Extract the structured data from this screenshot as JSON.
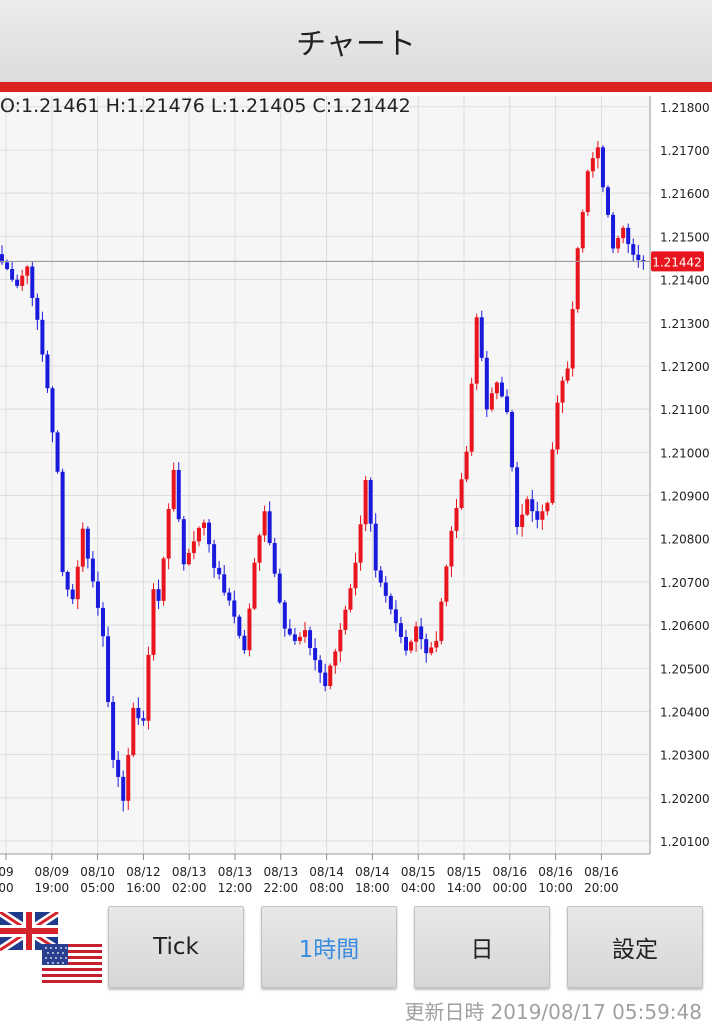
{
  "header": {
    "title": "チャート"
  },
  "ohlc": {
    "text": "O:1.21461 H:1.21476 L:1.21405 C:1.21442"
  },
  "chart_data": {
    "type": "candlestick",
    "y_ticks": [
      "1.21800",
      "1.21700",
      "1.21600",
      "1.21500",
      "1.21400",
      "1.21300",
      "1.21200",
      "1.21100",
      "1.21000",
      "1.20900",
      "1.20800",
      "1.20700",
      "1.20600",
      "1.20500",
      "1.20400",
      "1.20300",
      "1.20200",
      "1.20100"
    ],
    "ylim": [
      1.2007,
      1.21825
    ],
    "current_price": 1.21442,
    "current_price_label": "1.21442",
    "x_labels": [
      {
        "date": "09",
        "time": "00"
      },
      {
        "date": "08/09",
        "time": "19:00"
      },
      {
        "date": "08/10",
        "time": "05:00"
      },
      {
        "date": "08/12",
        "time": "16:00"
      },
      {
        "date": "08/13",
        "time": "02:00"
      },
      {
        "date": "08/13",
        "time": "12:00"
      },
      {
        "date": "08/13",
        "time": "22:00"
      },
      {
        "date": "08/14",
        "time": "08:00"
      },
      {
        "date": "08/14",
        "time": "18:00"
      },
      {
        "date": "08/15",
        "time": "04:00"
      },
      {
        "date": "08/15",
        "time": "14:00"
      },
      {
        "date": "08/16",
        "time": "00:00"
      },
      {
        "date": "08/16",
        "time": "10:00"
      },
      {
        "date": "08/16",
        "time": "20:00"
      }
    ],
    "colors": {
      "up": "#e8141e",
      "down": "#1a1adc"
    },
    "anchors": [
      [
        0,
        1.2144
      ],
      [
        3,
        1.2139
      ],
      [
        5,
        1.2143
      ],
      [
        7,
        1.213
      ],
      [
        9,
        1.2115
      ],
      [
        11,
        1.2095
      ],
      [
        12,
        1.2072
      ],
      [
        14,
        1.2066
      ],
      [
        16,
        1.2082
      ],
      [
        18,
        1.207
      ],
      [
        20,
        1.2058
      ],
      [
        22,
        1.2028
      ],
      [
        24,
        1.202
      ],
      [
        26,
        1.204
      ],
      [
        28,
        1.2038
      ],
      [
        30,
        1.2068
      ],
      [
        31,
        1.2066
      ],
      [
        33,
        1.2086
      ],
      [
        34,
        1.2096
      ],
      [
        36,
        1.2074
      ],
      [
        38,
        1.208
      ],
      [
        40,
        1.2084
      ],
      [
        42,
        1.2074
      ],
      [
        44,
        1.2068
      ],
      [
        46,
        1.2062
      ],
      [
        48,
        1.2054
      ],
      [
        50,
        1.2074
      ],
      [
        52,
        1.2087
      ],
      [
        54,
        1.2072
      ],
      [
        56,
        1.206
      ],
      [
        58,
        1.2056
      ],
      [
        60,
        1.2058
      ],
      [
        62,
        1.2052
      ],
      [
        64,
        1.2046
      ],
      [
        66,
        1.2054
      ],
      [
        68,
        1.2064
      ],
      [
        70,
        1.2074
      ],
      [
        72,
        1.2094
      ],
      [
        74,
        1.2072
      ],
      [
        76,
        1.2066
      ],
      [
        78,
        1.206
      ],
      [
        80,
        1.2054
      ],
      [
        82,
        1.206
      ],
      [
        84,
        1.2054
      ],
      [
        86,
        1.2056
      ],
      [
        88,
        1.2074
      ],
      [
        90,
        1.2088
      ],
      [
        92,
        1.21
      ],
      [
        94,
        1.2132
      ],
      [
        96,
        1.211
      ],
      [
        98,
        1.2116
      ],
      [
        100,
        1.211
      ],
      [
        102,
        1.2082
      ],
      [
        104,
        1.209
      ],
      [
        106,
        1.2084
      ],
      [
        108,
        1.2088
      ],
      [
        110,
        1.2112
      ],
      [
        112,
        1.212
      ],
      [
        114,
        1.2148
      ],
      [
        116,
        1.2165
      ],
      [
        118,
        1.217
      ],
      [
        119,
        1.2162
      ],
      [
        121,
        1.2148
      ],
      [
        123,
        1.2152
      ],
      [
        125,
        1.2146
      ],
      [
        127,
        1.2144
      ]
    ]
  },
  "flags": {
    "icon_gb": "uk-flag-icon",
    "icon_us": "us-flag-icon"
  },
  "buttons": {
    "tick": "Tick",
    "hour": "1時間",
    "day": "日",
    "settings": "設定"
  },
  "footer": {
    "updated_label": "更新日時",
    "updated_value": "2019/08/17 05:59:48"
  }
}
